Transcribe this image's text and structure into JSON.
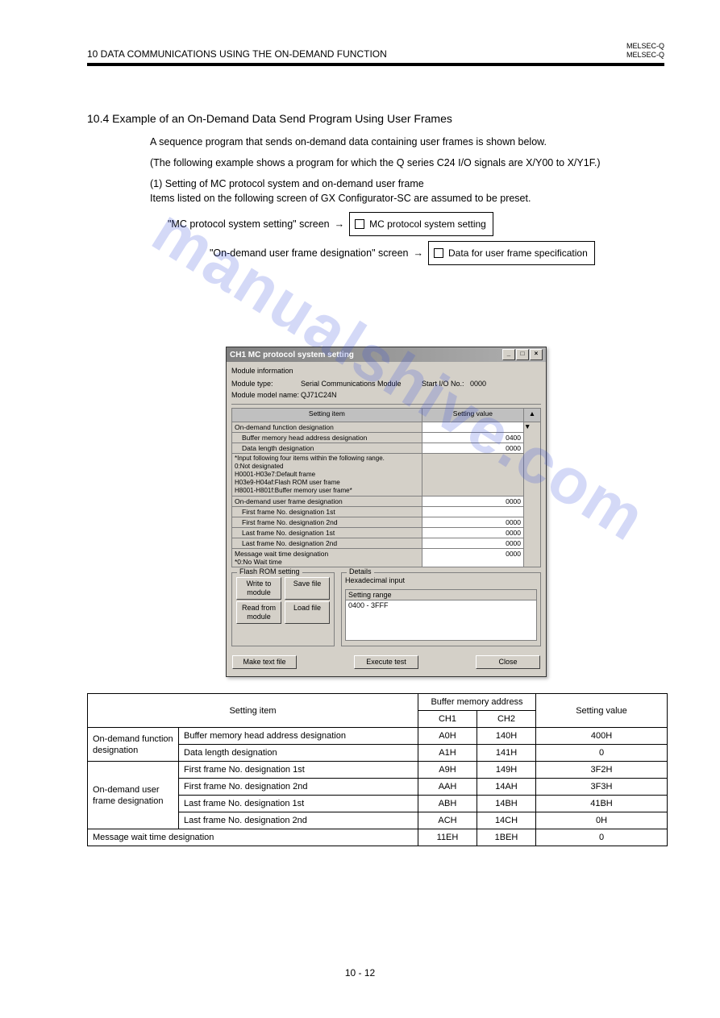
{
  "header": {
    "chapter": "10   DATA COMMUNICATIONS USING THE ON-DEMAND FUNCTION",
    "melsec": "MELSEC-Q",
    "melsec_sub": "MELSEC-Q"
  },
  "section": {
    "title": "10.4 Example of an On-Demand Data Send Program Using User Frames",
    "intro": "A sequence program that sends on-demand data containing user frames is shown below.",
    "note": "(The following example shows a program for which the Q series C24 I/O signals are X/Y00 to X/Y1F.)",
    "sub_num": "(1)",
    "sub_title": "Setting of MC protocol system and on-demand user frame",
    "sub_body": "Items listed on the following screen of GX Configurator-SC are assumed to be preset.",
    "step1_label": "\"MC protocol system setting\" screen",
    "step1_arrow": "→",
    "step1_box": "☐ MC protocol system setting",
    "step2_label": "\"On-demand user frame designation\" screen",
    "step2_arrow": "→",
    "step2_box": "☐ Data for user frame specification"
  },
  "dialog": {
    "title": "CH1 MC protocol system setting",
    "winbtns": {
      "min": "_",
      "max": "□",
      "close": "×"
    },
    "modinfo": {
      "type_label": "Module type:",
      "type_value": "Serial Communications Module",
      "io_label": "Start I/O No.:",
      "io_value": "0000",
      "model_label": "Module model name:",
      "model_value": "QJ71C24N"
    },
    "grid": {
      "header_item": "Setting item",
      "header_value": "Setting value",
      "rows": [
        {
          "label": "On-demand function designation",
          "value": ""
        },
        {
          "label": "Buffer memory head address designation",
          "value": "0400",
          "indent": true
        },
        {
          "label": "Data length designation",
          "value": "0000",
          "indent": true
        },
        {
          "label_info": "*Input following four items within the following range.\n0:Not designated\nH0001-H03e7:Default frame\nH03e9-H04af:Flash ROM user frame\nH8001-H801f:Buffer memory user frame*"
        },
        {
          "label": "On-demand user frame designation",
          "value": "0000"
        },
        {
          "label": "First frame No. designation 1st",
          "value": "",
          "indent": true
        },
        {
          "label": "First frame No. designation 2nd",
          "value": "0000",
          "indent": true
        },
        {
          "label": "Last frame No. designation 1st",
          "value": "0000",
          "indent": true
        },
        {
          "label": "Last frame No. designation 2nd",
          "value": "0000",
          "indent": true
        },
        {
          "label": "Message wait time designation\n*0:No Wait time",
          "value": "0000"
        }
      ]
    },
    "flash": {
      "legend": "Flash ROM setting",
      "write": "Write to\nmodule",
      "save": "Save file",
      "read": "Read from\nmodule",
      "load": "Load file"
    },
    "details": {
      "legend": "Details",
      "hex": "Hexadecimal input",
      "range_label": "Setting range",
      "range_value": "0400 - 3FFF"
    },
    "footer": {
      "make": "Make text file",
      "exec": "Execute test",
      "close": "Close"
    }
  },
  "main_table": {
    "headers": {
      "setting_item": "Setting item",
      "buffer": "Buffer memory address",
      "ch1": "CH1",
      "ch2": "CH2",
      "value": "Setting value"
    },
    "rows": [
      {
        "group": "On-demand function designation",
        "items": [
          {
            "label": "Buffer memory head address designation",
            "ch1": "A0H",
            "ch2": "140H",
            "value": "400H"
          },
          {
            "label": "Data length designation",
            "ch1": "A1H",
            "ch2": "141H",
            "value": "0"
          }
        ]
      },
      {
        "group": "On-demand user frame designation",
        "items": [
          {
            "label": "First frame No. designation 1st",
            "ch1": "A9H",
            "ch2": "149H",
            "value": "3F2H"
          },
          {
            "label": "First frame No. designation 2nd",
            "ch1": "AAH",
            "ch2": "14AH",
            "value": "3F3H"
          },
          {
            "label": "Last frame No. designation 1st",
            "ch1": "ABH",
            "ch2": "14BH",
            "value": "41BH"
          },
          {
            "label": "Last frame No. designation 2nd",
            "ch1": "ACH",
            "ch2": "14CH",
            "value": "0H"
          }
        ]
      },
      {
        "group": "Message wait time designation",
        "items": [
          {
            "label": "",
            "ch1": "11EH",
            "ch2": "1BEH",
            "value": "0"
          }
        ]
      }
    ]
  },
  "pageno": "10 - 12"
}
